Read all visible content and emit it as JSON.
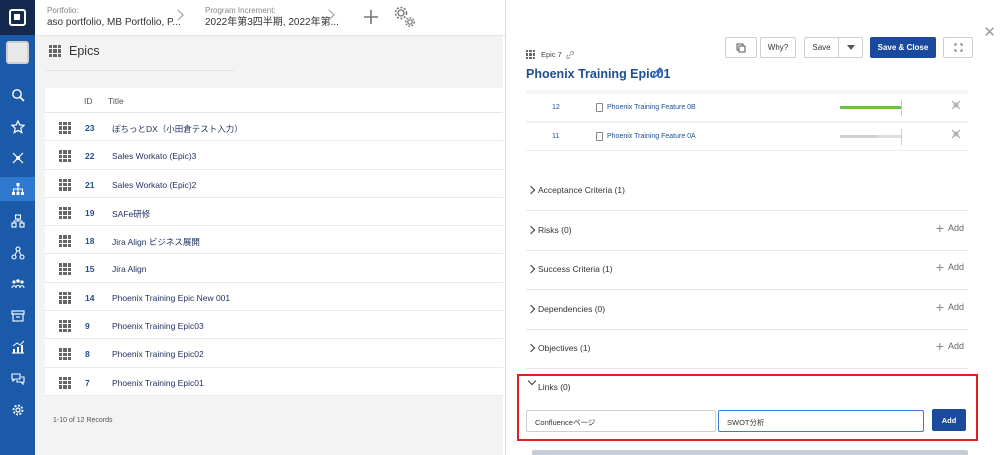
{
  "header": {
    "portfolio_label": "Portfolio:",
    "portfolio_value": "aso portfolio, MB Portfolio, P...",
    "pi_label": "Program Increment:",
    "pi_value": "2022年第3四半期, 2022年第..."
  },
  "list": {
    "title": "Epics",
    "columns": {
      "id": "ID",
      "title": "Title"
    },
    "rows": [
      {
        "id": "23",
        "title": "ぽちっとDX（小田倉テスト入力）"
      },
      {
        "id": "22",
        "title": "Sales Workato (Epic)3"
      },
      {
        "id": "21",
        "title": "Sales Workato (Epic)2"
      },
      {
        "id": "19",
        "title": "SAFe研修"
      },
      {
        "id": "18",
        "title": "Jira Align ビジネス展開"
      },
      {
        "id": "15",
        "title": "Jira Align"
      },
      {
        "id": "14",
        "title": "Phoenix Training Epic New 001"
      },
      {
        "id": "9",
        "title": "Phoenix Training Epic03"
      },
      {
        "id": "8",
        "title": "Phoenix Training Epic02"
      },
      {
        "id": "7",
        "title": "Phoenix Training Epic01"
      }
    ],
    "records": "1-10 of 12 Records"
  },
  "detail": {
    "buttons": {
      "why": "Why?",
      "save": "Save",
      "save_close": "Save & Close"
    },
    "epic_tag": "Epic 7",
    "title": "Phoenix Training Epic01",
    "features": [
      {
        "id": "12",
        "name": "Phoenix Training Feature 0B",
        "progress": 1.0
      },
      {
        "id": "11",
        "name": "Phoenix Training Feature 0A",
        "progress": 0.6
      }
    ],
    "sections": [
      {
        "title": "Acceptance Criteria (1)",
        "add": ""
      },
      {
        "title": "Risks (0)",
        "add": "Add"
      },
      {
        "title": "Success Criteria (1)",
        "add": "Add"
      },
      {
        "title": "Dependencies (0)",
        "add": "Add"
      },
      {
        "title": "Objectives (1)",
        "add": "Add"
      }
    ],
    "links": {
      "title": "Links (0)",
      "name_value": "Confluenceページ",
      "url_value": "SWOT分析",
      "add_label": "Add"
    }
  },
  "colors": {
    "rail": "#1a5aa8",
    "rail_top": "#14294d",
    "primary": "#1a4a9e",
    "highlight": "#e02020",
    "progress": "#6cbf4b"
  }
}
